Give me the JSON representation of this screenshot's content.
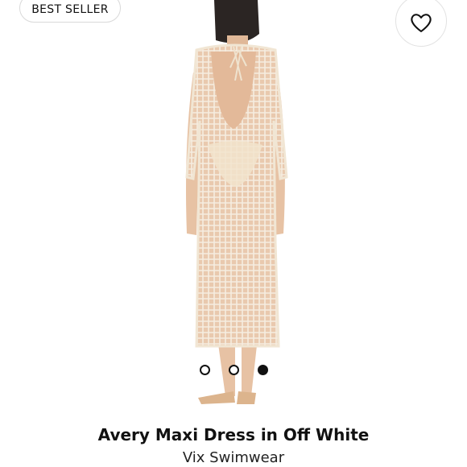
{
  "badge": {
    "label": "BEST SELLER"
  },
  "favorite": {
    "icon": "heart-icon"
  },
  "gallery": {
    "slide_count": 3,
    "active_index": 2
  },
  "product": {
    "name": "Avery Maxi Dress in Off White",
    "brand": "Vix Swimwear"
  },
  "colors": {
    "dress": "#f3e8d6",
    "skin": "#e7c2a4",
    "hair": "#2b2523"
  }
}
